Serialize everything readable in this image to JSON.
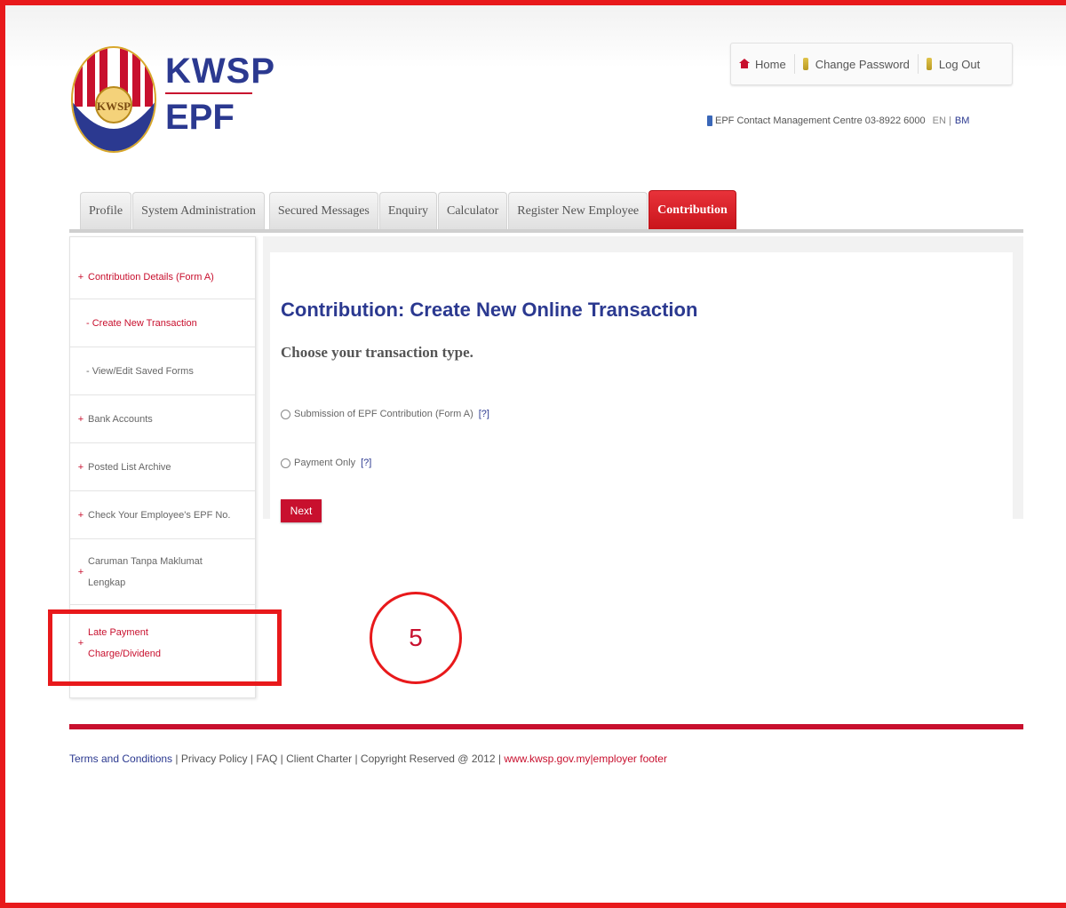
{
  "brand": {
    "top": "KWSP",
    "bottom": "EPF"
  },
  "toplinks": [
    {
      "label": "Home",
      "icon": "home-icon"
    },
    {
      "label": "Change Password",
      "icon": "key-icon"
    },
    {
      "label": "Log Out",
      "icon": "key-icon"
    }
  ],
  "contact": {
    "text": "EPF Contact Management Centre 03-8922 6000",
    "en": "EN |",
    "bm": "BM"
  },
  "tabs": [
    {
      "label": "Profile",
      "active": false
    },
    {
      "label": "System Administration",
      "active": false
    },
    {
      "label": "Secured Messages",
      "active": false
    },
    {
      "label": "Enquiry",
      "active": false
    },
    {
      "label": "Calculator",
      "active": false
    },
    {
      "label": "Register New Employee",
      "active": false
    },
    {
      "label": "Contribution",
      "active": true
    }
  ],
  "sidebar": {
    "items": [
      {
        "label": "Contribution Details (Form A)",
        "plus": "+"
      },
      {
        "label": "- Create New Transaction"
      },
      {
        "label": "- View/Edit Saved Forms"
      },
      {
        "label": "Bank Accounts",
        "plus": "+"
      },
      {
        "label": "Posted List Archive",
        "plus": "+"
      },
      {
        "label": "Check Your Employee's EPF No.",
        "plus": "+"
      },
      {
        "label": "Caruman Tanpa Maklumat Lengkap",
        "plus": "+"
      },
      {
        "label": "Late Payment Charge/Dividend",
        "plus": "+"
      }
    ]
  },
  "main": {
    "title": "Contribution: Create New Online Transaction",
    "subtitle": "Choose your transaction type.",
    "options": [
      {
        "label": "Submission of EPF Contribution (Form A)",
        "help": "[?]"
      },
      {
        "label": "Payment Only",
        "help": "[?]"
      }
    ],
    "next_label": "Next"
  },
  "annotation": {
    "step": "5"
  },
  "footer": {
    "terms": "Terms and Conditions",
    "rest": " | Privacy Policy | FAQ | Client Charter | Copyright Reserved @ 2012 | ",
    "url": "www.kwsp.gov.my|employer footer"
  },
  "colors": {
    "brand_blue": "#2b3990",
    "brand_red": "#c8102e",
    "annotation_red": "#e8191b"
  }
}
